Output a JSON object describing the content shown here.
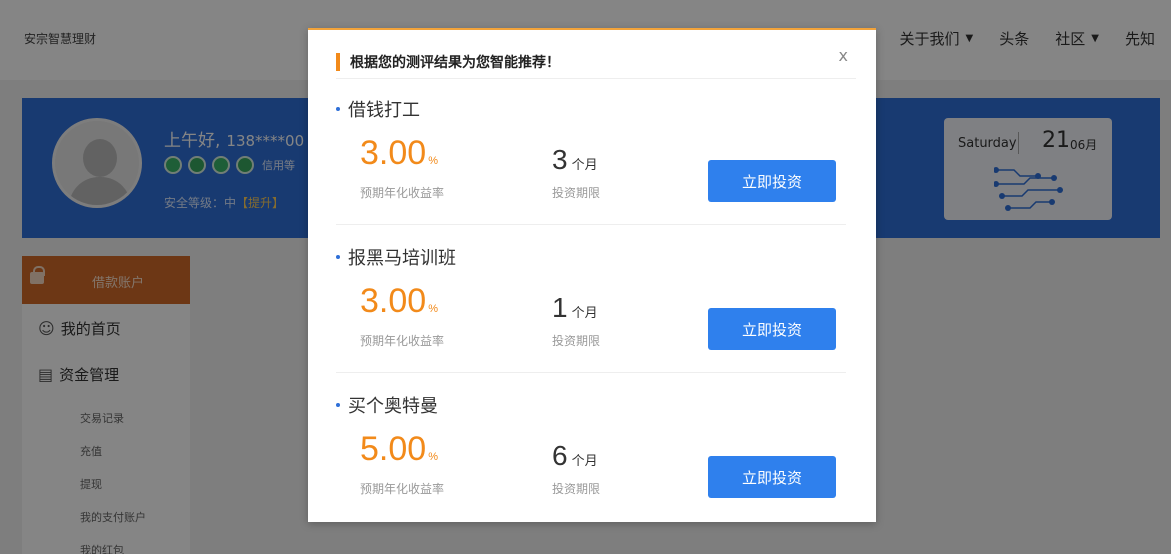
{
  "background_page": {
    "brand": "安宗智慧理财",
    "nav": [
      {
        "label": "关于我们",
        "has_caret": true
      },
      {
        "label": "头条",
        "has_caret": false
      },
      {
        "label": "社区",
        "has_caret": true
      },
      {
        "label": "先知",
        "has_caret": false
      }
    ],
    "user": {
      "greeting": "上午好,",
      "phone_masked": "138****00",
      "credit_label": "信用等",
      "security_text": "安全等级：中",
      "security_action": "【提升】"
    },
    "date_card": {
      "weekday": "Saturday",
      "day": "21",
      "month": "06月"
    },
    "sidebar": {
      "account_label": "借款账户",
      "items": [
        {
          "label": "我的首页",
          "icon": "user-icon"
        },
        {
          "label": "资金管理",
          "icon": "wallet-icon"
        }
      ],
      "sub_items": [
        "交易记录",
        "充值",
        "提现",
        "我的支付账户",
        "我的红包"
      ]
    }
  },
  "modal": {
    "title": "根据您的测评结果为您智能推荐！",
    "close_label": "x",
    "recommendations": [
      {
        "name": "借钱打工",
        "rate": "3.00",
        "rate_unit": "%",
        "rate_label": "预期年化收益率",
        "term": "3",
        "term_unit": "个月",
        "term_label": "投资期限",
        "button": "立即投资"
      },
      {
        "name": "报黑马培训班",
        "rate": "3.00",
        "rate_unit": "%",
        "rate_label": "预期年化收益率",
        "term": "1",
        "term_unit": "个月",
        "term_label": "投资期限",
        "button": "立即投资"
      },
      {
        "name": "买个奥特曼",
        "rate": "5.00",
        "rate_unit": "%",
        "rate_label": "预期年化收益率",
        "term": "6",
        "term_unit": "个月",
        "term_label": "投资期限",
        "button": "立即投资"
      }
    ]
  },
  "colors": {
    "accent_orange": "#f28a1a",
    "button_blue": "#2f80ed",
    "banner_blue": "#2e6fd8"
  }
}
